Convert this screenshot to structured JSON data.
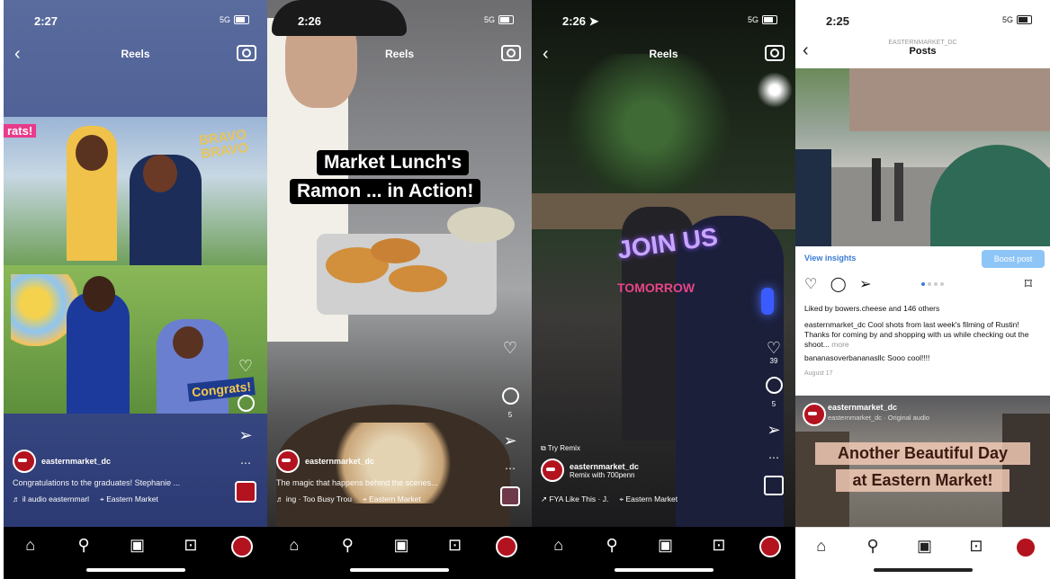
{
  "phones": [
    {
      "time": "2:27",
      "signal": "5G",
      "header": {
        "title": "Reels"
      },
      "scene_stickers": [
        "rats!",
        "BRAVO BRAVO",
        "Congrats!"
      ],
      "rail": {
        "likes": "",
        "comments": ""
      },
      "caption": {
        "user": "easternmarket_dc",
        "text": "Congratulations to the graduates! Stephanie ...",
        "audio": "♬ il audio easternmarl",
        "location": "Eastern Market"
      }
    },
    {
      "time": "2:26",
      "signal": "5G",
      "header": {
        "title": "Reels"
      },
      "overlay": {
        "line1": "Market Lunch's",
        "line2": "Ramon ... in Action!"
      },
      "rail": {
        "comments": "5"
      },
      "caption": {
        "user": "easternmarket_dc",
        "text": "The magic that happens behind the scenes...",
        "audio": "♬ ing · Too Busy Trou",
        "location": "Eastern Market"
      }
    },
    {
      "time": "2:26",
      "signal": "5G",
      "header": {
        "title": "Reels"
      },
      "overlay": {
        "line1": "JOIN US",
        "line2": "TOMORROW"
      },
      "rail": {
        "likes": "39",
        "comments": "5"
      },
      "caption": {
        "try_remix": "Try Remix",
        "user": "easternmarket_dc",
        "remix": "Remix with 700penn",
        "audio": "FYA Like This · J.",
        "location": "Eastern Market"
      }
    },
    {
      "time": "2:25",
      "signal": "5G",
      "header": {
        "subtitle": "EASTERNMARKET_DC",
        "title": "Posts"
      },
      "insights": {
        "view": "View insights",
        "boost": "Boost post"
      },
      "post": {
        "liked_by": "Liked by bowers.cheese and 146 others",
        "caption": "easternmarket_dc Cool shots from last week's filming of Rustin! Thanks for coming by and shopping with us while checking out the shoot...",
        "more": "more",
        "comment": "bananasoverbananasllc Sooo cool!!!!",
        "date": "August 17"
      },
      "post2": {
        "user": "easternmarket_dc",
        "sub": "easternmarket_dc · Original audio",
        "banner1": "Another Beautiful Day",
        "banner2": "at Eastern Market!"
      }
    }
  ],
  "colors": {
    "brand_red": "#b3121f",
    "link_blue": "#3a7bd5",
    "boost_blue": "#8ec5f7"
  },
  "icons": [
    "back-chevron-icon",
    "camera-icon",
    "heart-icon",
    "comment-icon",
    "share-icon",
    "more-icon",
    "home-icon",
    "search-icon",
    "reels-icon",
    "shop-icon",
    "profile-icon",
    "bookmark-icon",
    "location-pin-icon",
    "music-note-icon"
  ]
}
